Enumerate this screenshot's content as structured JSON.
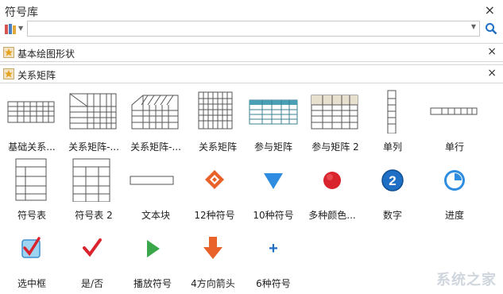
{
  "window": {
    "title": "符号库",
    "close_glyph": "×"
  },
  "search": {
    "value": "",
    "placeholder": ""
  },
  "libraries": [
    {
      "label": "基本绘图形状",
      "close_glyph": "×"
    },
    {
      "label": "关系矩阵",
      "close_glyph": "×"
    }
  ],
  "symbols": [
    {
      "label": "基础关系..."
    },
    {
      "label": "关系矩阵-..."
    },
    {
      "label": "关系矩阵-..."
    },
    {
      "label": "关系矩阵"
    },
    {
      "label": "参与矩阵"
    },
    {
      "label": "参与矩阵 2"
    },
    {
      "label": "单列"
    },
    {
      "label": "单行"
    },
    {
      "label": "符号表"
    },
    {
      "label": "符号表 2"
    },
    {
      "label": "文本块"
    },
    {
      "label": "12种符号"
    },
    {
      "label": "10种符号"
    },
    {
      "label": "多种颜色..."
    },
    {
      "label": "数字"
    },
    {
      "label": "进度"
    },
    {
      "label": "选中框"
    },
    {
      "label": "是/否"
    },
    {
      "label": "播放符号"
    },
    {
      "label": "4方向箭头"
    },
    {
      "label": "6种符号"
    }
  ],
  "icon_texts": {
    "number_badge": "2",
    "plus": "+"
  },
  "watermark": {
    "text": "系统之家"
  },
  "colors": {
    "accent_blue": "#1f6fc5",
    "orange": "#e8622a",
    "red": "#d9232d",
    "green": "#3aa84a",
    "teal_header": "#4a9fb5"
  }
}
